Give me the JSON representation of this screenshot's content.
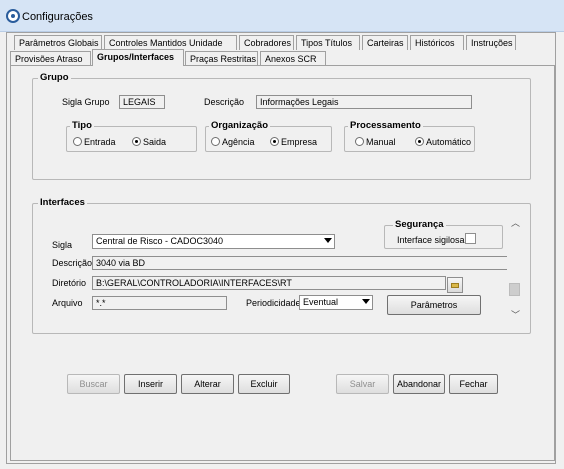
{
  "window": {
    "title": "Configurações"
  },
  "tabs_row1": [
    "Parâmetros Globais",
    "Controles Mantidos Unidade",
    "Cobradores",
    "Tipos Títulos",
    "Carteiras",
    "Históricos",
    "Instruções"
  ],
  "tabs_row2": [
    "Provisões Atraso",
    "Grupos/Interfaces",
    "Praças Restritas",
    "Anexos SCR"
  ],
  "active_tab": "Grupos/Interfaces",
  "grupo": {
    "title": "Grupo",
    "sigla_label": "Sigla Grupo",
    "sigla_value": "LEGAIS",
    "descricao_label": "Descrição",
    "descricao_value": "Informações Legais",
    "tipo": {
      "title": "Tipo",
      "options": [
        "Entrada",
        "Saida"
      ],
      "selected": "Saida"
    },
    "organizacao": {
      "title": "Organização",
      "options": [
        "Agência",
        "Empresa"
      ],
      "selected": "Empresa"
    },
    "processamento": {
      "title": "Processamento",
      "options": [
        "Manual",
        "Automático"
      ],
      "selected": "Automático"
    }
  },
  "interfaces": {
    "title": "Interfaces",
    "seguranca": {
      "title": "Segurança",
      "checkbox_label": "Interface sigilosa",
      "checked": false
    },
    "sigla_label": "Sigla",
    "sigla_value": "Central de Risco - CADOC3040",
    "descricao_label": "Descrição",
    "descricao_value": "3040 via BD",
    "diretorio_label": "Diretório",
    "diretorio_value": "B:\\GERAL\\CONTROLADORIA\\INTERFACES\\RT",
    "arquivo_label": "Arquivo",
    "arquivo_value": "*.*",
    "periodicidade_label": "Periodicidade",
    "periodicidade_value": "Eventual",
    "parametros_label": "Parâmetros"
  },
  "buttons": {
    "buscar": {
      "label": "Buscar",
      "enabled": false
    },
    "inserir": {
      "label": "Inserir",
      "enabled": true
    },
    "alterar": {
      "label": "Alterar",
      "enabled": true
    },
    "excluir": {
      "label": "Excluir",
      "enabled": true
    },
    "salvar": {
      "label": "Salvar",
      "enabled": false
    },
    "abandonar": {
      "label": "Abandonar",
      "enabled": true
    },
    "fechar": {
      "label": "Fechar",
      "enabled": true
    }
  }
}
